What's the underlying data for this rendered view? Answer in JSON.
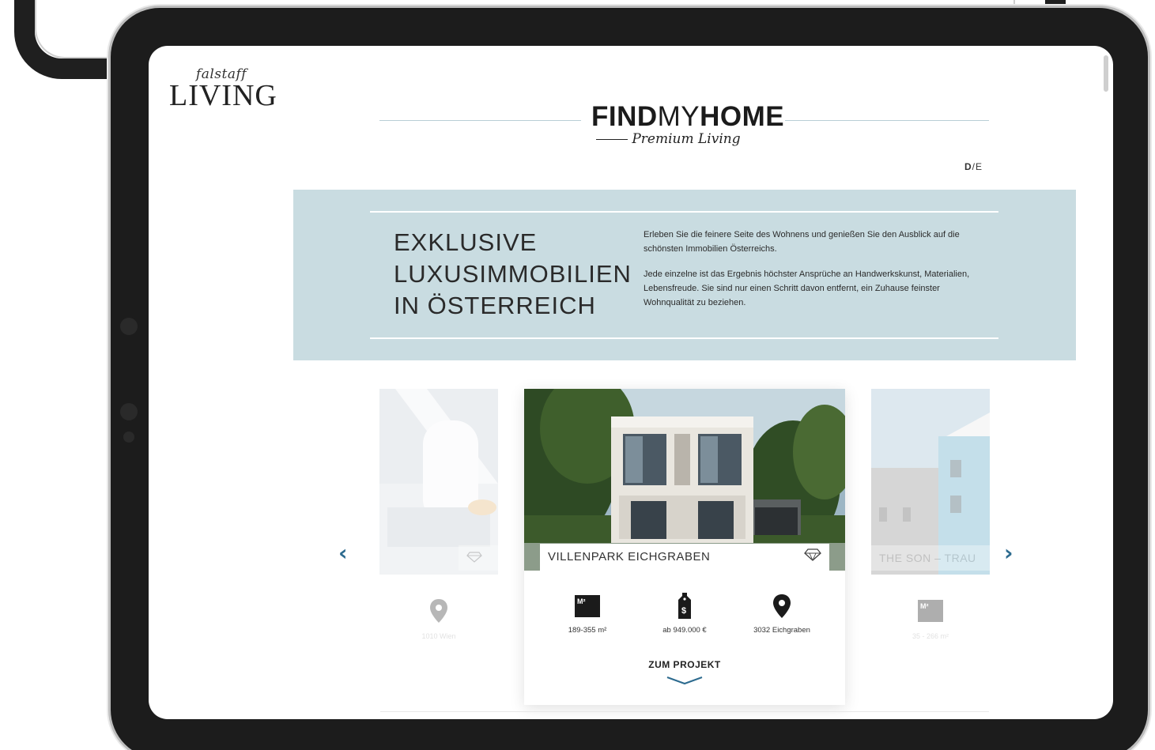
{
  "logo": {
    "small": "falstaff",
    "big": "LIVING"
  },
  "brand": {
    "title_bold_1": "FIND",
    "title_light": "MY",
    "title_bold_2": "HOME",
    "subtitle": "Premium Living"
  },
  "language": {
    "current": "D",
    "separator": "/",
    "other": "E"
  },
  "hero": {
    "title_lines": [
      "EXKLUSIVE",
      "LUXUSIMMOBILIEN",
      "IN ÖSTERREICH"
    ],
    "paragraph_1": "Erleben Sie die feinere Seite des Wohnens und genießen Sie den Ausblick auf die schönsten Immobilien Österreichs.",
    "paragraph_2": "Jede einzelne ist das Ergebnis höchster Ansprüche an Handwerkskunst, Materialien, Lebensfreude. Sie sind nur einen Schritt davon entfernt, ein Zuhause feinster Wohnqualität zu beziehen."
  },
  "carousel": {
    "prev_icon": "chevron-left-icon",
    "next_icon": "chevron-right-icon",
    "left_card": {
      "location": "1010 Wien"
    },
    "main_card": {
      "name": "VILLENPARK EICHGRABEN",
      "area": "189-355 m²",
      "price": "ab 949.000 €",
      "location": "3032 Eichgraben",
      "cta": "ZUM PROJEKT"
    },
    "right_card": {
      "name": "THE SON – TRAU",
      "area": "35 - 266 m²",
      "area_icon_label": "M²"
    }
  },
  "colors": {
    "accent": "#2d6b8f",
    "hero_bg": "#c9dce1",
    "bezel": "#1c1c1c"
  }
}
